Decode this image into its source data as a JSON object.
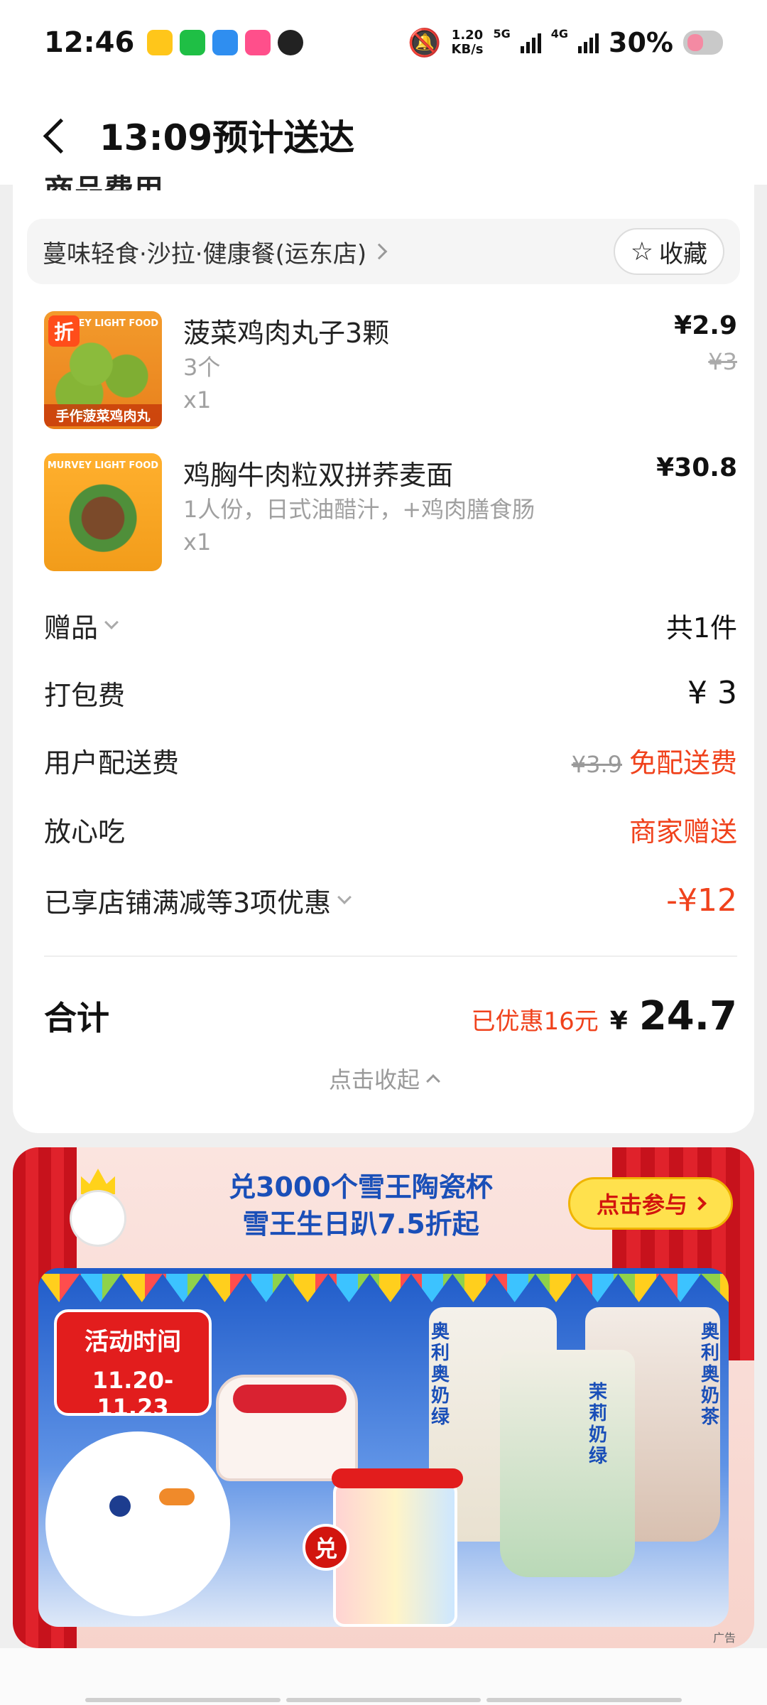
{
  "status_bar": {
    "time": "12:46",
    "net_speed_value": "1.20",
    "net_speed_unit": "KB/s",
    "sim1": "5G",
    "sim2": "4G",
    "battery": "30%"
  },
  "header": {
    "title": "13:09预计送达"
  },
  "section": {
    "peek_title": "商品费用"
  },
  "store": {
    "name": "蔓味轻食·沙拉·健康餐(运东店)",
    "favorite_label": "收藏"
  },
  "items": [
    {
      "name": "菠菜鸡肉丸子3颗",
      "spec": "3个",
      "qty": "x1",
      "price": "¥2.9",
      "original_price": "¥3",
      "badge": "折",
      "image_caption": "手作菠菜鸡肉丸",
      "image_brand": "MURVEY LIGHT FOOD"
    },
    {
      "name": "鸡胸牛肉粒双拼荞麦面",
      "spec": "1人份，日式油醋汁，+鸡肉膳食肠",
      "qty": "x1",
      "price": "¥30.8",
      "image_brand": "MURVEY LIGHT FOOD"
    }
  ],
  "fees": {
    "gift_label": "赠品",
    "gift_value": "共1件",
    "packing_label": "打包费",
    "packing_value": "¥ 3",
    "delivery_label": "用户配送费",
    "delivery_original": "¥3.9",
    "delivery_value": "免配送费",
    "assurance_label": "放心吃",
    "assurance_value": "商家赠送",
    "discount_label": "已享店铺满减等3项优惠",
    "discount_value": "-¥12"
  },
  "total": {
    "label": "合计",
    "saved": "已优惠16元",
    "currency": "¥",
    "amount": "24.7",
    "collapse_label": "点击收起"
  },
  "ad": {
    "title_line1": "兑3000个雪王陶瓷杯",
    "title_line2": "雪王生日趴7.5折起",
    "button_label": "点击参与",
    "event_label": "活动时间",
    "event_dates": "11.20-11.23",
    "redeem_badge": "兑",
    "cup_label_1": "奥利奥奶绿",
    "cup_label_2": "茉莉奶绿",
    "cup_label_3": "奥利奥奶茶",
    "ad_tag": "广告"
  },
  "colors": {
    "accent_red": "#f0421c",
    "banner_blue": "#1a4fb8",
    "button_yellow": "#ffe14d"
  }
}
